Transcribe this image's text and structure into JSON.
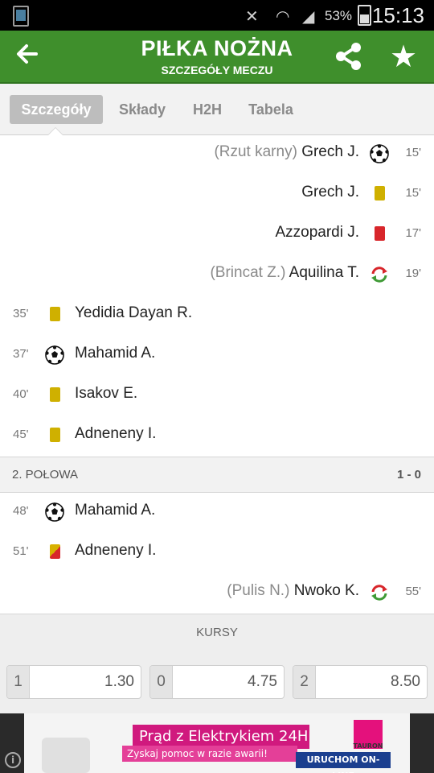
{
  "status_bar": {
    "battery": "53%",
    "time": "15:13"
  },
  "header": {
    "title": "PIŁKA NOŻNA",
    "subtitle": "SZCZEGÓŁY MECZU"
  },
  "tabs": [
    {
      "label": "Szczegóły",
      "active": true
    },
    {
      "label": "Składy",
      "active": false
    },
    {
      "label": "H2H",
      "active": false
    },
    {
      "label": "Tabela",
      "active": false
    }
  ],
  "events_first_half": [
    {
      "side": "away",
      "minute": "15'",
      "player": "Grech J.",
      "extra": "(Rzut karny)",
      "type": "goal"
    },
    {
      "side": "away",
      "minute": "15'",
      "player": "Grech J.",
      "extra": "",
      "type": "yellow-card"
    },
    {
      "side": "away",
      "minute": "17'",
      "player": "Azzopardi J.",
      "extra": "",
      "type": "red-card"
    },
    {
      "side": "away",
      "minute": "19'",
      "player": "Aquilina T.",
      "extra": "(Brincat Z.)",
      "type": "substitution"
    },
    {
      "side": "home",
      "minute": "35'",
      "player": "Yedidia Dayan R.",
      "extra": "",
      "type": "yellow-card"
    },
    {
      "side": "home",
      "minute": "37'",
      "player": "Mahamid A.",
      "extra": "",
      "type": "goal"
    },
    {
      "side": "home",
      "minute": "40'",
      "player": "Isakov E.",
      "extra": "",
      "type": "yellow-card"
    },
    {
      "side": "home",
      "minute": "45'",
      "player": "Adneneny I.",
      "extra": "",
      "type": "yellow-card"
    }
  ],
  "second_half": {
    "label": "2. POŁOWA",
    "score": "1 - 0"
  },
  "events_second_half": [
    {
      "side": "home",
      "minute": "48'",
      "player": "Mahamid A.",
      "extra": "",
      "type": "goal"
    },
    {
      "side": "home",
      "minute": "51'",
      "player": "Adneneny I.",
      "extra": "",
      "type": "second-yellow-card"
    },
    {
      "side": "away",
      "minute": "55'",
      "player": "Nwoko K.",
      "extra": "(Pulis N.)",
      "type": "substitution"
    }
  ],
  "odds": {
    "title": "KURSY",
    "items": [
      {
        "label": "1",
        "value": "1.30"
      },
      {
        "label": "0",
        "value": "4.75"
      },
      {
        "label": "2",
        "value": "8.50"
      }
    ]
  },
  "ad": {
    "headline": "Prąd z Elektrykiem 24H",
    "subline": "Zyskaj pomoc w razie awarii!",
    "cta": "URUCHOM ON-LINE",
    "brand": "TAURON"
  },
  "colors": {
    "header_green": "#3f8f2c",
    "yellow_card": "#cfb000",
    "red_card": "#d8262b"
  }
}
